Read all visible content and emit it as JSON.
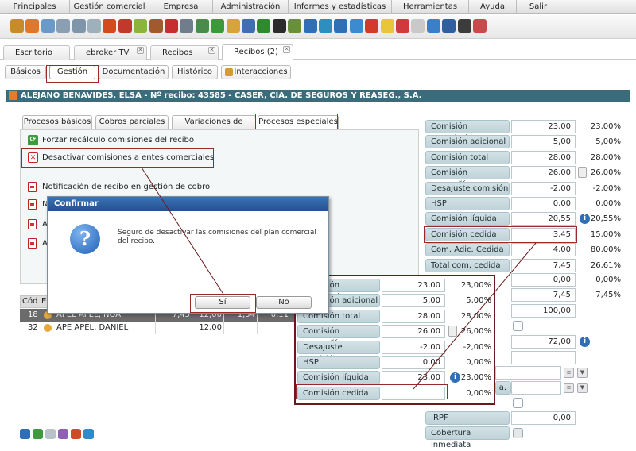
{
  "menu": [
    "Principales",
    "Gestión comercial",
    "Empresa",
    "Administración",
    "Informes y estadísticas",
    "Herramientas",
    "Ayuda",
    "Salir"
  ],
  "toolbar_icons": [
    {
      "name": "box-icon",
      "color": "#c98a2b"
    },
    {
      "name": "user-orange-icon",
      "color": "#e0782b"
    },
    {
      "name": "user-blue-icon",
      "color": "#6b9ac9"
    },
    {
      "name": "screen-icon",
      "color": "#8aa0b2"
    },
    {
      "name": "window-icon",
      "color": "#7f96aa"
    },
    {
      "name": "grid-icon",
      "color": "#9fb0bd"
    },
    {
      "name": "fire-icon",
      "color": "#d44a1f"
    },
    {
      "name": "target-icon",
      "color": "#c0392b"
    },
    {
      "name": "pencil-icon",
      "color": "#8cb43a"
    },
    {
      "name": "briefcase-icon",
      "color": "#a05a2c"
    },
    {
      "name": "first-aid-icon",
      "color": "#c62f2f"
    },
    {
      "name": "cube-icon",
      "color": "#6f7d8c"
    },
    {
      "name": "document-icon",
      "color": "#4a8a4a"
    },
    {
      "name": "traffic-light-icon",
      "color": "#3a9a3a"
    },
    {
      "name": "person-icon",
      "color": "#d8a33a"
    },
    {
      "name": "people-icon",
      "color": "#3f6fb0"
    },
    {
      "name": "check-arrow-icon",
      "color": "#2f8a2f"
    },
    {
      "name": "cancel-icon",
      "color": "#2b2b2b"
    },
    {
      "name": "bird-icon",
      "color": "#6a8f3a"
    },
    {
      "name": "c-blue-icon",
      "color": "#2f6fb6"
    },
    {
      "name": "recycle-icon",
      "color": "#2d8fbf"
    },
    {
      "name": "sync-icon",
      "color": "#2f6fb6"
    },
    {
      "name": "globe-icon",
      "color": "#3c8bd0"
    },
    {
      "name": "g-red-icon",
      "color": "#d23a2a"
    },
    {
      "name": "lightbulb-icon",
      "color": "#e8c53a"
    },
    {
      "name": "ie-icon",
      "color": "#d03a3a"
    },
    {
      "name": "page-icon",
      "color": "#c9c9c9"
    },
    {
      "name": "notepad-icon",
      "color": "#3a7fc9"
    },
    {
      "name": "phone-icon",
      "color": "#2f5fa0"
    },
    {
      "name": "tools-icon",
      "color": "#3c3c3c"
    },
    {
      "name": "question-icon",
      "color": "#c94a4a"
    }
  ],
  "tabs": [
    {
      "label": "Escritorio",
      "closable": false
    },
    {
      "label": "ebroker TV",
      "closable": true
    },
    {
      "label": "Recibos",
      "closable": true
    },
    {
      "label": "Recibos (2)",
      "closable": true
    }
  ],
  "subtabs": [
    "Básicos",
    "Gestión",
    "Documentación",
    "Histórico",
    "Interacciones"
  ],
  "header": "ALEJANO BENAVIDES, ELSA - Nº recibo: 43585 - CASER, CIA. DE SEGUROS Y REASEG., S.A.",
  "process_tabs": [
    "Procesos básicos",
    "Cobros parciales",
    "Variaciones de prima",
    "Procesos especiales"
  ],
  "actions": {
    "force_recalc": "Forzar recálculo comisiones del recibo",
    "deactivate": "Desactivar comisiones a entes comerciales"
  },
  "reports": {
    "r1": "Notificación de recibo en gestión de cobro",
    "r2": "No",
    "r3": "Av",
    "r4": "Av"
  },
  "grid": {
    "headers": [
      "Cód",
      "En"
    ],
    "rows": [
      {
        "code": "18",
        "name": "APEL APEL, NOA",
        "v1": "7,45",
        "v2": "12,00",
        "v3": "1,54",
        "v4": "0,11"
      },
      {
        "code": "32",
        "name": "APE APEL, DANIEL",
        "v1": "",
        "v2": "12,00",
        "v3": "",
        "v4": ""
      }
    ]
  },
  "commission_form": [
    {
      "label": "Comisión correduría",
      "value": "23,00",
      "pct": "23,00%"
    },
    {
      "label": "Comisión adicional",
      "value": "5,00",
      "pct": "5,00%"
    },
    {
      "label": "Comisión total",
      "value": "28,00",
      "pct": "28,00%"
    },
    {
      "label": "Comisión compañía",
      "value": "26,00",
      "pct": "26,00%"
    },
    {
      "label": "Desajuste comisión",
      "value": "-2,00",
      "pct": "-2,00%"
    },
    {
      "label": "HSP",
      "value": "0,00",
      "pct": "0,00%"
    },
    {
      "label": "Comisión líquida",
      "value": "20,55",
      "pct": "20,55%"
    },
    {
      "label": "Comisión cedida",
      "value": "3,45",
      "pct": "15,00%"
    },
    {
      "label": "Com. Adic. Cedida",
      "value": "4,00",
      "pct": "80,00%"
    },
    {
      "label": "Total com. cedida",
      "value": "7,45",
      "pct": "26,61%"
    }
  ],
  "extra_values": {
    "v1": "0,00",
    "p1": "0,00%",
    "v2": "7,45",
    "p2": "7,45%",
    "v3": "100,00",
    "v4": "72,00",
    "label_frag1": "ia.",
    "irpf_label": "IRPF",
    "irpf_value": "0,00",
    "cobertura_label": "Cobertura inmediata"
  },
  "zoom_form": [
    {
      "label": "Comisión correduría",
      "value": "23,00",
      "pct": "23,00%"
    },
    {
      "label": "Comisión adicional",
      "value": "5,00",
      "pct": "5,00%"
    },
    {
      "label": "Comisión total",
      "value": "28,00",
      "pct": "28,00%"
    },
    {
      "label": "Comisión compañía",
      "value": "26,00",
      "pct": "26,00%"
    },
    {
      "label": "Desajuste comisión",
      "value": "-2,00",
      "pct": "-2,00%"
    },
    {
      "label": "HSP",
      "value": "0,00",
      "pct": "0,00%"
    },
    {
      "label": "Comisión líquida",
      "value": "23,00",
      "pct": "23,00%"
    },
    {
      "label": "Comisión cedida",
      "value": "",
      "pct": "0,00%"
    }
  ],
  "dialog": {
    "title": "Confirmar",
    "message": "Seguro de desactivar las comisiones del plan comercial del recibo.",
    "yes": "Sí",
    "no": "No"
  },
  "colors": {
    "header_bg": "#3b6c7b",
    "dialog_title": "#2a5a9a",
    "highlight_box": "#9a2a2a"
  }
}
